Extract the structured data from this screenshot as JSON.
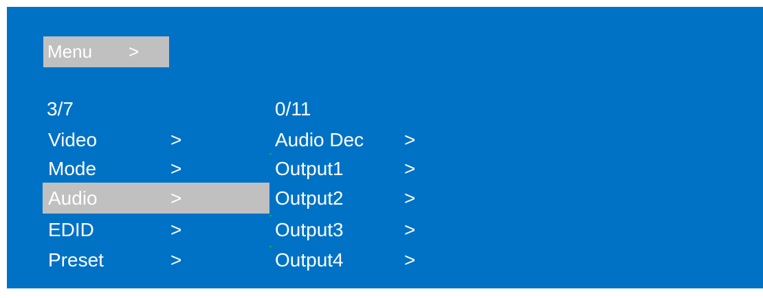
{
  "menu": {
    "title": "Menu",
    "arrow": ">"
  },
  "main_column": {
    "counter": "3/7",
    "items": [
      {
        "label": "Video",
        "arrow": ">"
      },
      {
        "label": "Mode",
        "arrow": ">"
      },
      {
        "label": "Audio",
        "arrow": ">"
      },
      {
        "label": "EDID",
        "arrow": ">"
      },
      {
        "label": "Preset",
        "arrow": ">"
      }
    ],
    "selected_label": "Audio"
  },
  "sub_column": {
    "counter": "0/11",
    "items": [
      {
        "label": "Audio Dec",
        "arrow": ">"
      },
      {
        "label": "Output1",
        "arrow": ">"
      },
      {
        "label": "Output2",
        "arrow": ">"
      },
      {
        "label": "Output3",
        "arrow": ">"
      },
      {
        "label": "Output4",
        "arrow": ">"
      }
    ]
  },
  "colors": {
    "background": "#0072c6",
    "highlight": "#c0c0c0",
    "text": "#ffffff"
  }
}
